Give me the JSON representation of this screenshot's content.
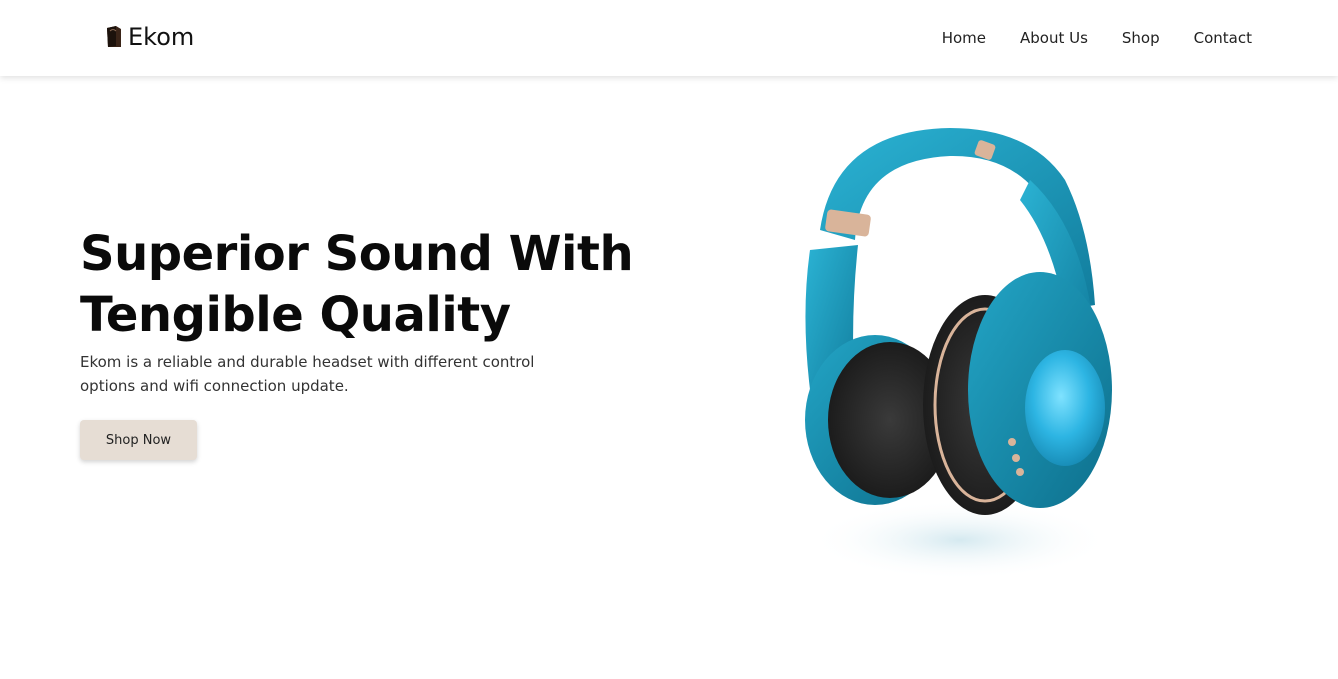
{
  "header": {
    "brand_name": "Ekom",
    "brand_icon": "shopping-bag-icon",
    "nav": [
      {
        "label": "Home"
      },
      {
        "label": "About Us"
      },
      {
        "label": "Shop"
      },
      {
        "label": "Contact"
      }
    ]
  },
  "hero": {
    "title_line1": "Superior Sound With",
    "title_line2": "Tengible Quality",
    "description": "Ekom is a reliable and durable headset with different control options and wifi connection update.",
    "cta_label": "Shop Now",
    "product_image": "teal-headphones-image"
  },
  "colors": {
    "background": "#ffffff",
    "cta_background": "#e6ddd4",
    "product_accent": "#1f9ec0",
    "text": "#0a0a0a"
  }
}
